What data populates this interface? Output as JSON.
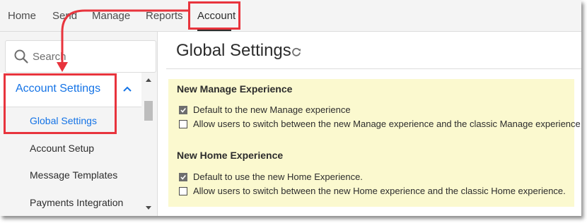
{
  "nav": {
    "items": [
      "Home",
      "Send",
      "Manage",
      "Reports",
      "Account"
    ],
    "active": "Account"
  },
  "sidebar": {
    "search_placeholder": "Search",
    "section_label": "Account Settings",
    "items": [
      "Global Settings",
      "Account Setup",
      "Message Templates",
      "Payments Integration"
    ],
    "active_item": "Global Settings"
  },
  "main": {
    "title": "Global Settings",
    "groups": [
      {
        "title": "New Manage Experience",
        "options": [
          {
            "label": "Default to the new Manage experience",
            "checked": true
          },
          {
            "label": "Allow users to switch between the new Manage experience and the classic Manage experience",
            "checked": false
          }
        ]
      },
      {
        "title": "New Home Experience",
        "options": [
          {
            "label": "Default to use the new Home Experience.",
            "checked": true
          },
          {
            "label": "Allow users to switch between the new Home experience and the classic Home experience.",
            "checked": false
          }
        ]
      }
    ]
  },
  "icons": {
    "search": "search-icon",
    "section_toggle": "chevron-up-icon",
    "refresh": "refresh-icon",
    "checkbox_checked": "checkmark-icon"
  },
  "colors": {
    "accent_blue": "#1473e6",
    "callout_red": "#e8343d",
    "panel_yellow": "#fbf9cf"
  }
}
